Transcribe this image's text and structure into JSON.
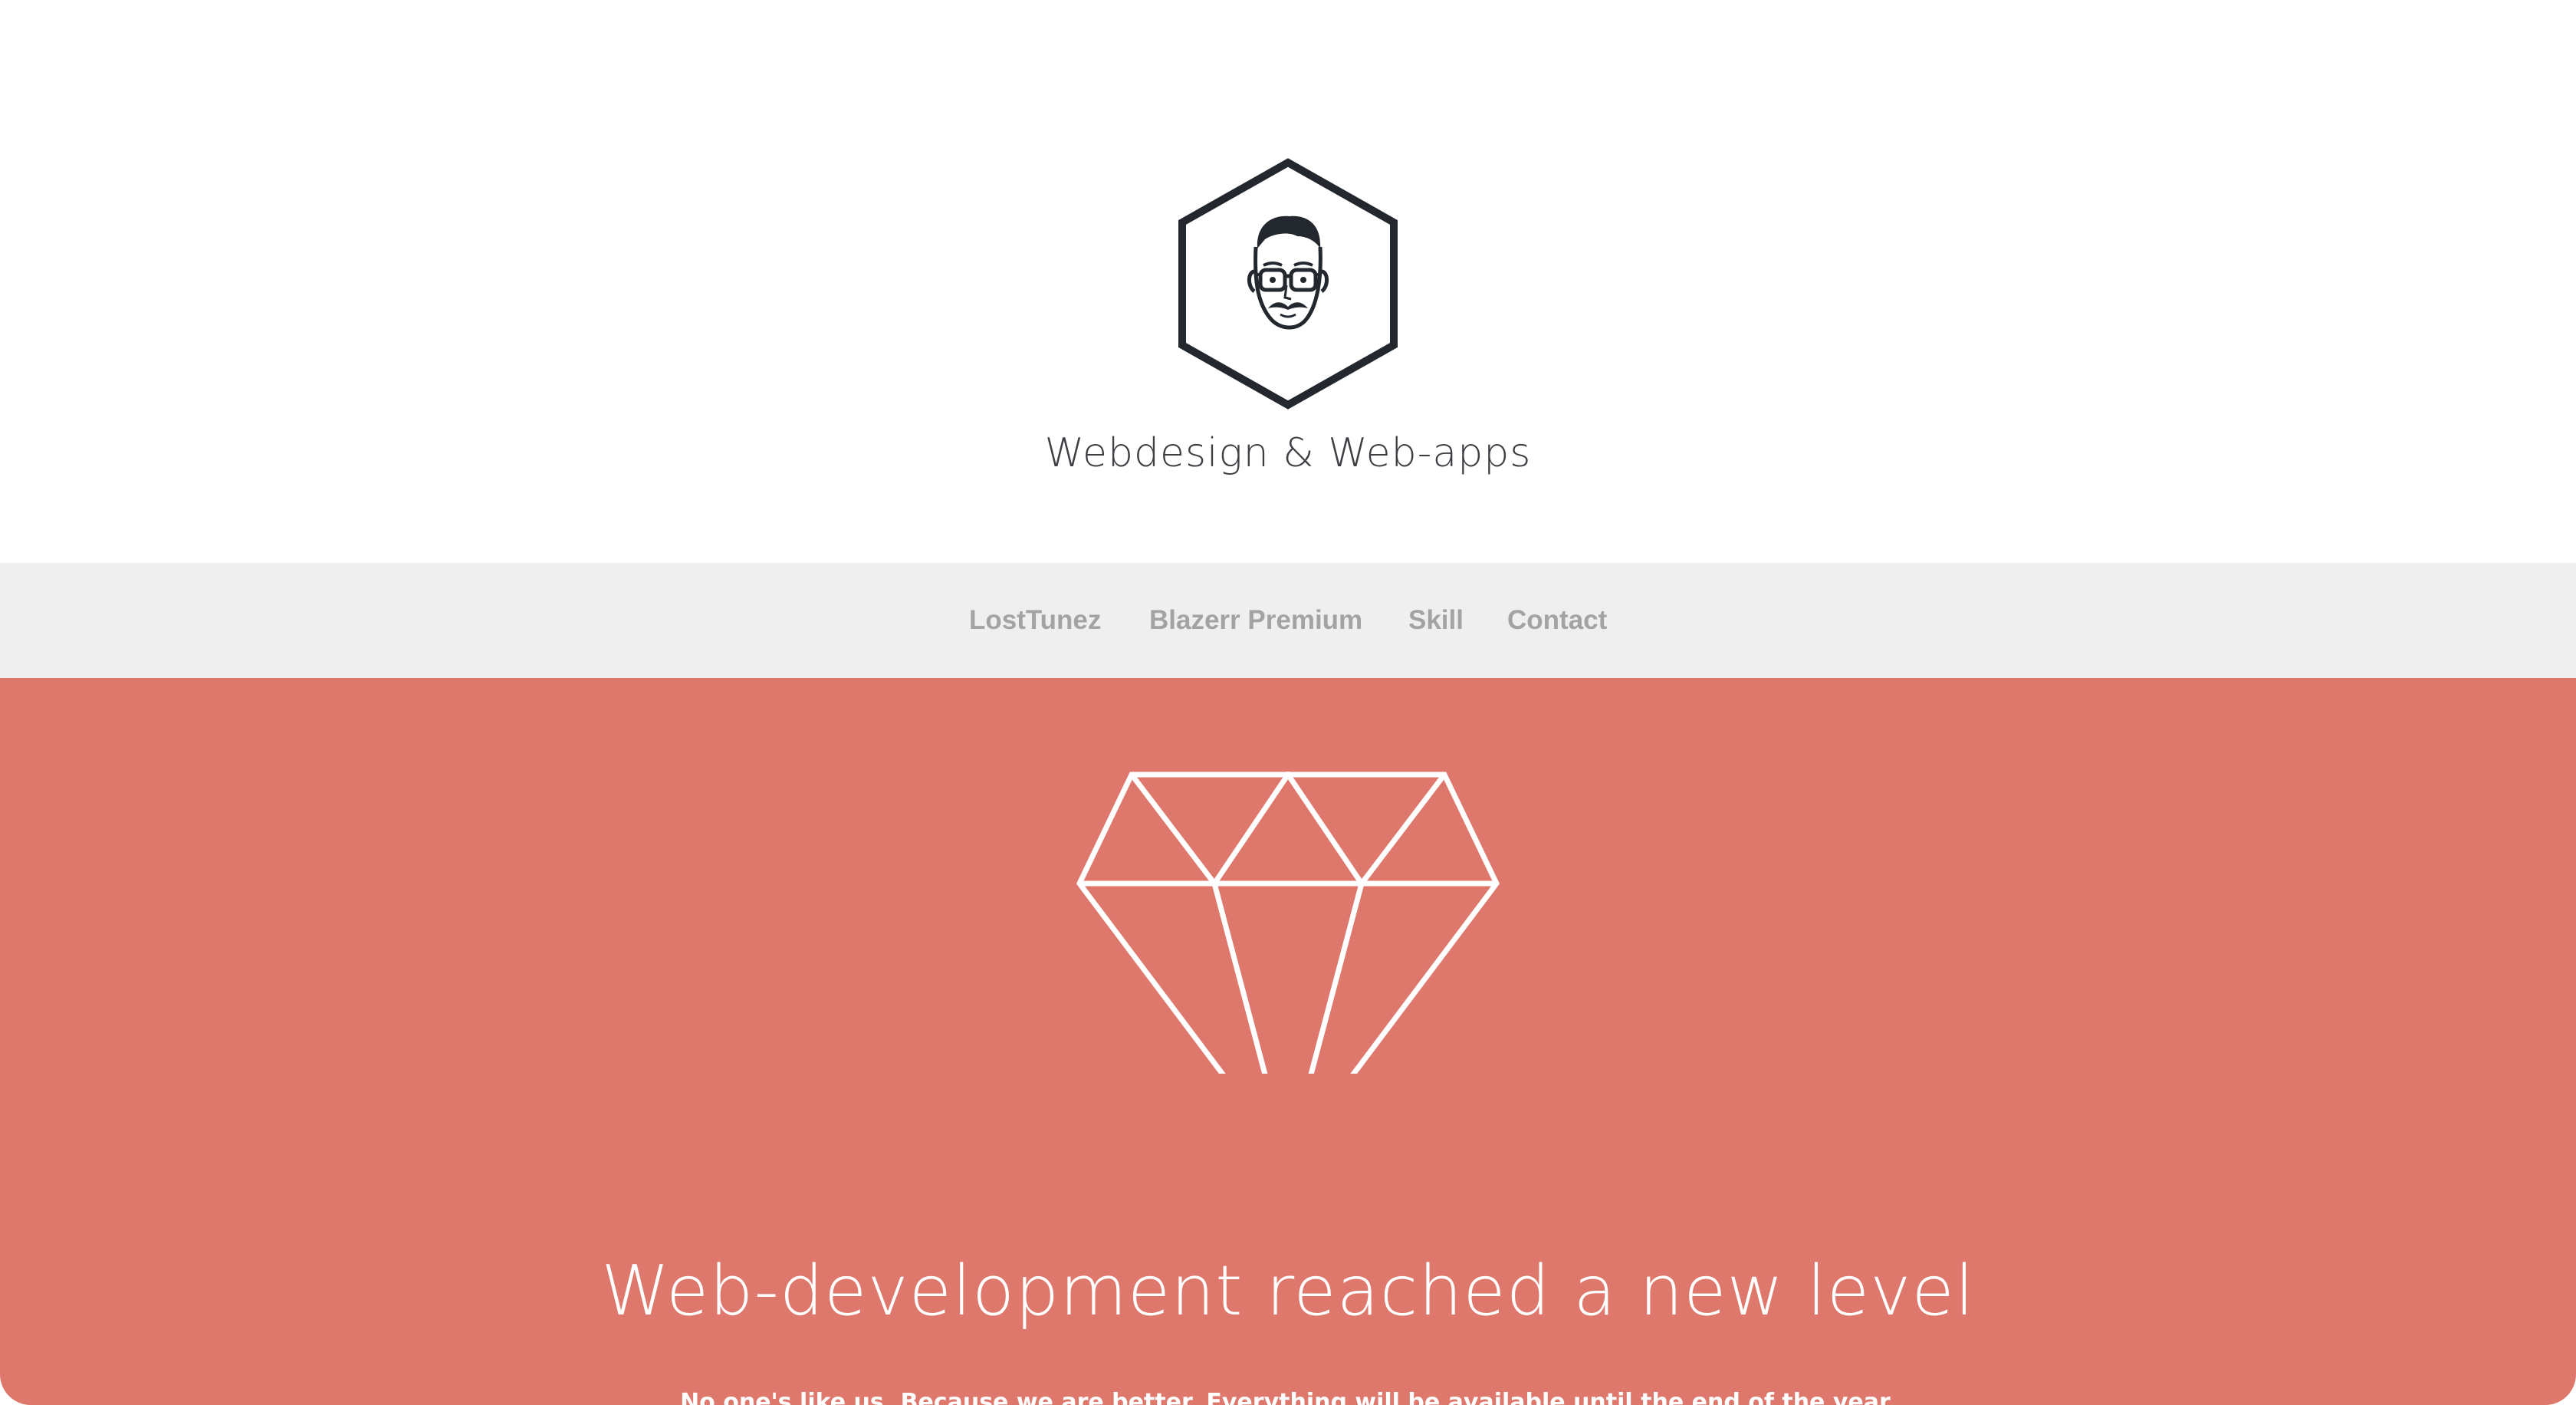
{
  "header": {
    "logo_icon": "hexagon-avatar-icon",
    "tagline": "Webdesign & Web-apps"
  },
  "nav": {
    "items": [
      {
        "label": "LostTunez"
      },
      {
        "label": "Blazerr Premium"
      },
      {
        "label": "Skill"
      },
      {
        "label": "Contact"
      }
    ]
  },
  "hero": {
    "icon": "diamond-icon",
    "title": "Web-development reached a new level",
    "subtitle": "No one's like us. Because we are better. Everything will be available until the end of the year.",
    "background_color": "#df786c"
  },
  "colors": {
    "nav_background": "#efefef",
    "nav_text": "#a3a3a3",
    "tagline_text": "#3d3f44",
    "logo_stroke": "#23272e"
  }
}
